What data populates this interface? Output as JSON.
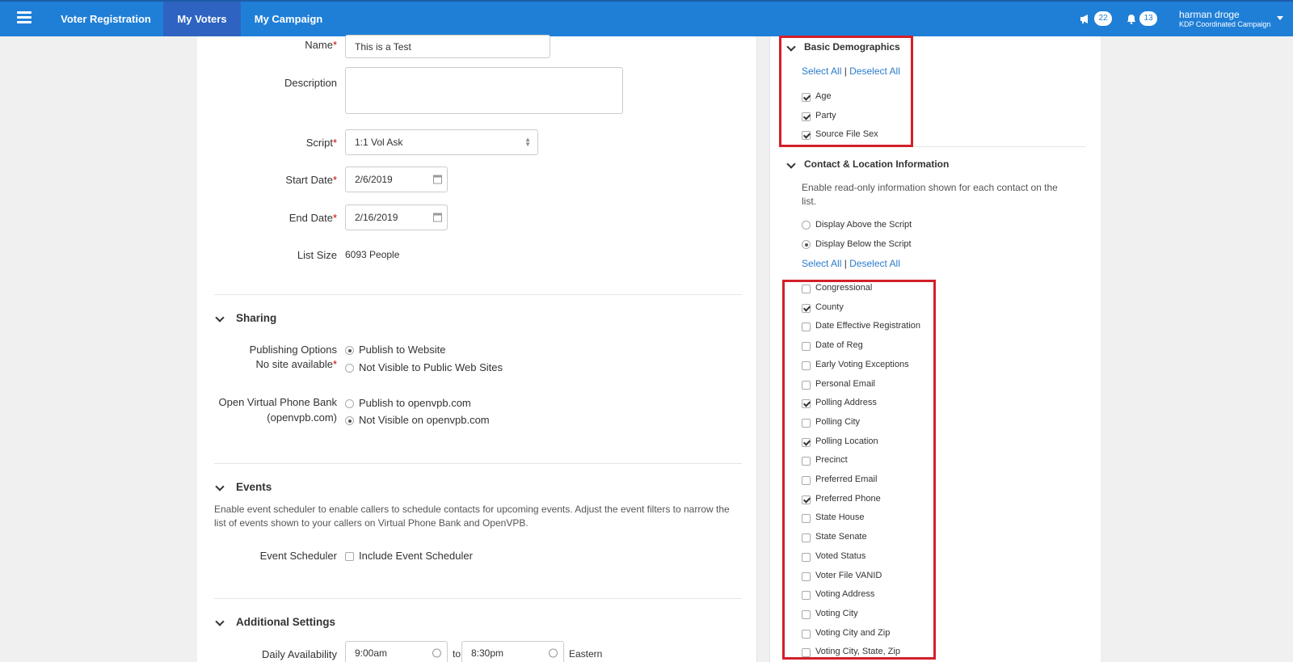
{
  "nav": {
    "tabs": [
      {
        "label": "Voter Registration"
      },
      {
        "label": "My Voters"
      },
      {
        "label": "My Campaign"
      }
    ],
    "announcements_count": "22",
    "notifications_count": "13",
    "user_name": "harman droge",
    "campaign": "KDP Coordinated Campaign"
  },
  "form": {
    "name_label": "Name",
    "name_value": "This is a Test",
    "description_label": "Description",
    "description_value": "",
    "script_label": "Script",
    "script_value": "1:1 Vol Ask",
    "start_label": "Start Date",
    "start_value": "2/6/2019",
    "end_label": "End Date",
    "end_value": "2/16/2019",
    "list_size_label": "List Size",
    "list_size_value": "6093 People"
  },
  "sharing": {
    "title": "Sharing",
    "publishing_label": "Publishing Options",
    "no_site_label": "No site available",
    "publish_options": [
      {
        "label": "Publish to Website",
        "selected": true
      },
      {
        "label": "Not Visible to Public Web Sites",
        "selected": false
      }
    ],
    "vpb_label": "Open Virtual Phone Bank",
    "vpb_sub": "(openvpb.com)",
    "vpb_options": [
      {
        "label": "Publish to openvpb.com",
        "selected": false
      },
      {
        "label": "Not Visible on openvpb.com",
        "selected": true
      }
    ]
  },
  "events": {
    "title": "Events",
    "description": "Enable event scheduler to enable callers to schedule contacts for upcoming events. Adjust the event filters to narrow the list of events shown to your callers on Virtual Phone Bank and OpenVPB.",
    "scheduler_label": "Event Scheduler",
    "include_label": "Include Event Scheduler",
    "include_checked": false
  },
  "additional": {
    "title": "Additional Settings",
    "daily_label": "Daily Availability",
    "from": "9:00am",
    "to_label": "to",
    "to": "8:30pm",
    "tz": "Eastern"
  },
  "demographics": {
    "title": "Basic Demographics",
    "select_all": "Select All",
    "sep": "|",
    "deselect_all": "Deselect All",
    "items": [
      {
        "label": "Age",
        "checked": true
      },
      {
        "label": "Party",
        "checked": true
      },
      {
        "label": "Source File Sex",
        "checked": true
      }
    ]
  },
  "contact": {
    "title": "Contact & Location Information",
    "description": "Enable read-only information shown for each contact on the list.",
    "display_options": [
      {
        "label": "Display Above the Script",
        "selected": false
      },
      {
        "label": "Display Below the Script",
        "selected": true
      }
    ],
    "select_all": "Select All",
    "sep": "|",
    "deselect_all": "Deselect All",
    "items": [
      {
        "label": "Congressional",
        "checked": false
      },
      {
        "label": "County",
        "checked": true
      },
      {
        "label": "Date Effective Registration",
        "checked": false
      },
      {
        "label": "Date of Reg",
        "checked": false
      },
      {
        "label": "Early Voting Exceptions",
        "checked": false
      },
      {
        "label": "Personal Email",
        "checked": false
      },
      {
        "label": "Polling Address",
        "checked": true
      },
      {
        "label": "Polling City",
        "checked": false
      },
      {
        "label": "Polling Location",
        "checked": true
      },
      {
        "label": "Precinct",
        "checked": false
      },
      {
        "label": "Preferred Email",
        "checked": false
      },
      {
        "label": "Preferred Phone",
        "checked": true
      },
      {
        "label": "State House",
        "checked": false
      },
      {
        "label": "State Senate",
        "checked": false
      },
      {
        "label": "Voted Status",
        "checked": false
      },
      {
        "label": "Voter File VANID",
        "checked": false
      },
      {
        "label": "Voting Address",
        "checked": false
      },
      {
        "label": "Voting City",
        "checked": false
      },
      {
        "label": "Voting City and Zip",
        "checked": false
      },
      {
        "label": "Voting City, State, Zip",
        "checked": false
      }
    ]
  },
  "colors": {
    "nav": "#1f7fd7",
    "nav_active": "#2e63c1",
    "link": "#2a7ccc",
    "highlight": "#d31f2a"
  }
}
